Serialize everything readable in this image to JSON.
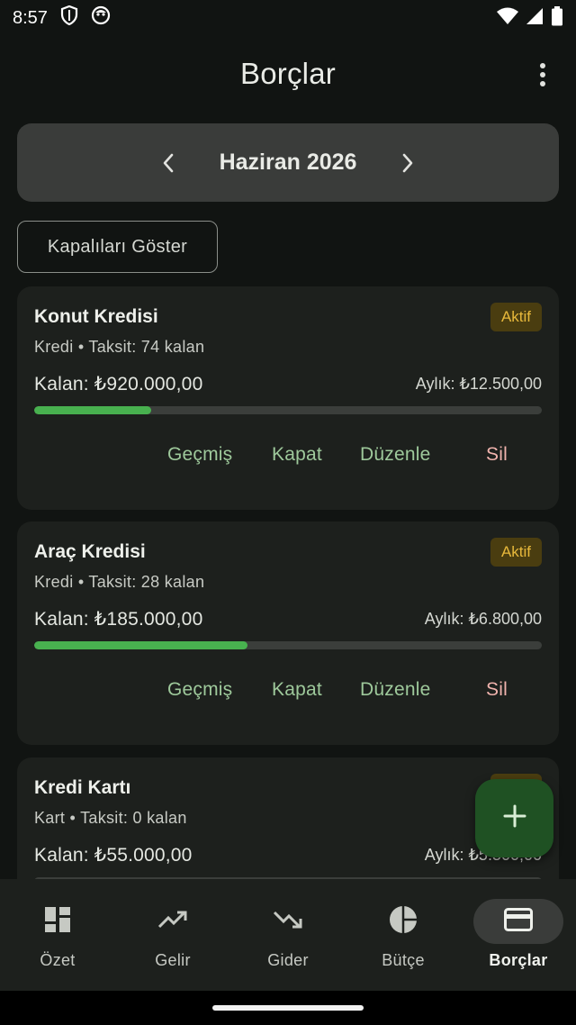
{
  "status_bar": {
    "time": "8:57"
  },
  "app_bar": {
    "title": "Borçlar"
  },
  "month_selector": {
    "label": "Haziran 2026"
  },
  "filter": {
    "show_closed_label": "Kapalıları Göster"
  },
  "debts": [
    {
      "name": "Konut Kredisi",
      "status": "Aktif",
      "subtitle": "Kredi • Taksit: 74 kalan",
      "remaining": "Kalan: ₺920.000,00",
      "monthly": "Aylık: ₺12.500,00",
      "progress": 0.23
    },
    {
      "name": "Araç Kredisi",
      "status": "Aktif",
      "subtitle": "Kredi • Taksit: 28 kalan",
      "remaining": "Kalan: ₺185.000,00",
      "monthly": "Aylık: ₺6.800,00",
      "progress": 0.42
    },
    {
      "name": "Kredi Kartı",
      "status": "Aktif",
      "subtitle": "Kart • Taksit: 0 kalan",
      "remaining": "Kalan: ₺55.000,00",
      "monthly": "Aylık: ₺5.500,00",
      "progress": 0.0
    }
  ],
  "actions": {
    "history": "Geçmiş",
    "close": "Kapat",
    "edit": "Düzenle",
    "delete": "Sil"
  },
  "nav": [
    {
      "label": "Özet",
      "icon": "dashboard-icon",
      "active": false
    },
    {
      "label": "Gelir",
      "icon": "trending-up-icon",
      "active": false
    },
    {
      "label": "Gider",
      "icon": "trending-down-icon",
      "active": false
    },
    {
      "label": "Bütçe",
      "icon": "pie-chart-icon",
      "active": false
    },
    {
      "label": "Borçlar",
      "icon": "credit-card-icon",
      "active": true
    }
  ],
  "colors": {
    "background": "#111412",
    "card": "#1d201d",
    "accent_green": "#48b14f",
    "action_green": "#9ec99b",
    "delete_red": "#f0b3ad",
    "badge_bg": "#4a3d10",
    "badge_text": "#e7b83b",
    "fab": "#1f5123"
  }
}
